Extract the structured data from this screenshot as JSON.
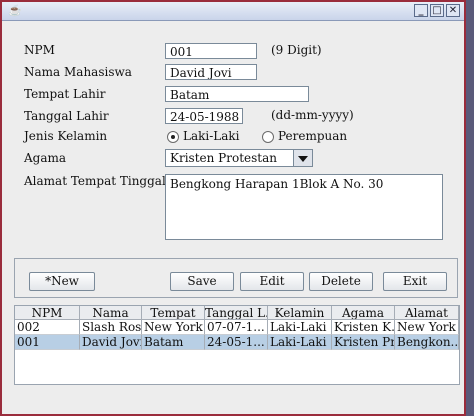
{
  "form": {
    "npm_label": "NPM",
    "npm_value": "001",
    "npm_hint": "(9 Digit)",
    "nama_label": "Nama Mahasiswa",
    "nama_value": "David Jovi",
    "tempat_label": "Tempat Lahir",
    "tempat_value": "Batam",
    "tanggal_label": "Tanggal Lahir",
    "tanggal_value": "24-05-1988",
    "tanggal_hint": "(dd-mm-yyyy)",
    "kelamin_label": "Jenis Kelamin",
    "kelamin_options": [
      "Laki-Laki",
      "Perempuan"
    ],
    "kelamin_selected": "Laki-Laki",
    "agama_label": "Agama",
    "agama_value": "Kristen Protestan",
    "alamat_label": "Alamat Tempat Tinggal",
    "alamat_value": "Bengkong Harapan 1Blok A No. 30"
  },
  "buttons": {
    "new": "*New",
    "save": "Save",
    "edit": "Edit",
    "delete": "Delete",
    "exit": "Exit"
  },
  "table": {
    "headers": [
      "NPM",
      "Nama",
      "Tempat",
      "Tanggal L...",
      "Kelamin",
      "Agama",
      "Alamat"
    ],
    "rows": [
      [
        "002",
        "Slash Rose",
        "New York",
        "07-07-1...",
        "Laki-Laki",
        "Kristen K...",
        "New York"
      ],
      [
        "001",
        "David Jovi",
        "Batam",
        "24-05-1...",
        "Laki-Laki",
        "Kristen Pr...",
        "Bengkon..."
      ]
    ],
    "selected_row": 1
  },
  "colors": {
    "selection": "#b8cfe5",
    "window_frame": "#9a2c3c"
  }
}
